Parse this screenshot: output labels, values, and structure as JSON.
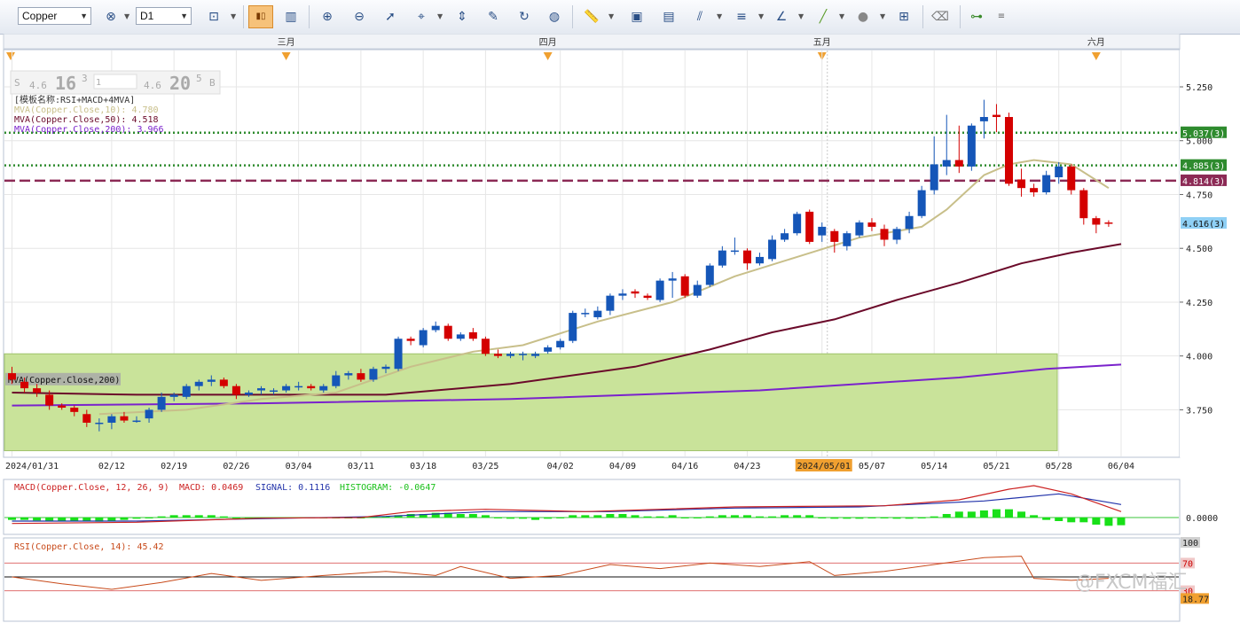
{
  "toolbar": {
    "symbol": "Copper",
    "timeframe": "D1",
    "icons": [
      "indicator-remove-icon",
      "chart-type-icon",
      "candlestick-icon",
      "bar-chart-icon",
      "zoom-in-icon",
      "zoom-out-icon",
      "cursor-icon",
      "crosshair-data-icon",
      "fit-icon",
      "properties-icon",
      "refresh-icon",
      "globe-icon",
      "ruler-icon",
      "image-icon",
      "snapshot-icon",
      "fibonacci-icon",
      "horizontal-lines-icon",
      "trend-tools-icon",
      "pen-icon",
      "ellipse-icon",
      "add-indicator-icon",
      "eraser-icon",
      "tree-icon",
      "more-icon"
    ]
  },
  "chart_data": [
    {
      "type": "candlestick",
      "symbol": "Copper",
      "timeframe": "D1",
      "month_labels": [
        "三月",
        "四月",
        "五月",
        "六月"
      ],
      "x_tick_labels": [
        "2024/01/31",
        "02/12",
        "02/19",
        "02/26",
        "03/04",
        "03/11",
        "03/18",
        "03/25",
        "04/02",
        "04/09",
        "04/16",
        "04/23",
        "2024/05/01",
        "05/07",
        "05/14",
        "05/21",
        "05/28",
        "06/04"
      ],
      "y_ticks": [
        "5.250",
        "5.000",
        "4.750",
        "4.500",
        "4.250",
        "4.000",
        "3.750"
      ],
      "ylim": [
        3.55,
        5.32
      ],
      "grid": true,
      "template_label": "[模板名称:RSI+MACD+4MVA]",
      "price_box": {
        "sell_prefix": "S",
        "sell_small": "4.6",
        "sell_big": "16",
        "sell_sup": "3",
        "lot": "1",
        "buy_small": "4.6",
        "buy_big": "20",
        "buy_sup": "5",
        "buy_suffix": "B"
      },
      "legend": [
        {
          "text": "MVA(Copper.Close,10): 4.780",
          "color": "#c8bf8a"
        },
        {
          "text": "MVA(Copper.Close,50): 4.518",
          "color": "#6b0a2a"
        },
        {
          "text": "MVA(Copper.Close,200): 3.966",
          "color": "#7a22cc"
        }
      ],
      "zone_label": "MVA(Copper.Close,200)",
      "zone": {
        "y_from": 3.56,
        "y_to": 4.01
      },
      "hlines": [
        {
          "value": 5.037,
          "label": "5.037(3)",
          "style": "dotted",
          "color": "#2e8b2e"
        },
        {
          "value": 4.885,
          "label": "4.885(3)",
          "style": "dotted",
          "color": "#2e8b2e"
        },
        {
          "value": 4.814,
          "label": "4.814(3)",
          "style": "dashed",
          "color": "#8c2a55"
        }
      ],
      "last_price_label": "4.616(3)",
      "last_price": 4.616,
      "candles": [
        {
          "o": 3.92,
          "c": 3.89,
          "h": 3.95,
          "l": 3.87
        },
        {
          "o": 3.88,
          "c": 3.85,
          "h": 3.9,
          "l": 3.83
        },
        {
          "o": 3.85,
          "c": 3.83,
          "h": 3.87,
          "l": 3.81
        },
        {
          "o": 3.82,
          "c": 3.77,
          "h": 3.84,
          "l": 3.75
        },
        {
          "o": 3.77,
          "c": 3.76,
          "h": 3.78,
          "l": 3.75
        },
        {
          "o": 3.76,
          "c": 3.74,
          "h": 3.77,
          "l": 3.72
        },
        {
          "o": 3.73,
          "c": 3.69,
          "h": 3.75,
          "l": 3.67
        },
        {
          "o": 3.69,
          "c": 3.69,
          "h": 3.71,
          "l": 3.65
        },
        {
          "o": 3.69,
          "c": 3.72,
          "h": 3.73,
          "l": 3.66
        },
        {
          "o": 3.72,
          "c": 3.7,
          "h": 3.74,
          "l": 3.69
        },
        {
          "o": 3.7,
          "c": 3.7,
          "h": 3.72,
          "l": 3.69
        },
        {
          "o": 3.71,
          "c": 3.75,
          "h": 3.76,
          "l": 3.69
        },
        {
          "o": 3.75,
          "c": 3.81,
          "h": 3.83,
          "l": 3.74
        },
        {
          "o": 3.81,
          "c": 3.82,
          "h": 3.83,
          "l": 3.79
        },
        {
          "o": 3.81,
          "c": 3.86,
          "h": 3.87,
          "l": 3.8
        },
        {
          "o": 3.86,
          "c": 3.88,
          "h": 3.89,
          "l": 3.84
        },
        {
          "o": 3.88,
          "c": 3.89,
          "h": 3.91,
          "l": 3.86
        },
        {
          "o": 3.89,
          "c": 3.86,
          "h": 3.9,
          "l": 3.85
        },
        {
          "o": 3.86,
          "c": 3.82,
          "h": 3.87,
          "l": 3.8
        },
        {
          "o": 3.82,
          "c": 3.83,
          "h": 3.84,
          "l": 3.81
        },
        {
          "o": 3.84,
          "c": 3.85,
          "h": 3.86,
          "l": 3.82
        },
        {
          "o": 3.84,
          "c": 3.84,
          "h": 3.85,
          "l": 3.82
        },
        {
          "o": 3.84,
          "c": 3.86,
          "h": 3.87,
          "l": 3.83
        },
        {
          "o": 3.86,
          "c": 3.86,
          "h": 3.88,
          "l": 3.84
        },
        {
          "o": 3.86,
          "c": 3.85,
          "h": 3.87,
          "l": 3.84
        },
        {
          "o": 3.84,
          "c": 3.86,
          "h": 3.87,
          "l": 3.83
        },
        {
          "o": 3.86,
          "c": 3.91,
          "h": 3.93,
          "l": 3.85
        },
        {
          "o": 3.91,
          "c": 3.92,
          "h": 3.93,
          "l": 3.89
        },
        {
          "o": 3.92,
          "c": 3.89,
          "h": 3.94,
          "l": 3.88
        },
        {
          "o": 3.89,
          "c": 3.94,
          "h": 3.95,
          "l": 3.88
        },
        {
          "o": 3.94,
          "c": 3.95,
          "h": 3.96,
          "l": 3.92
        },
        {
          "o": 3.94,
          "c": 4.08,
          "h": 4.09,
          "l": 3.93
        },
        {
          "o": 4.08,
          "c": 4.07,
          "h": 4.09,
          "l": 4.05
        },
        {
          "o": 4.05,
          "c": 4.12,
          "h": 4.13,
          "l": 4.04
        },
        {
          "o": 4.12,
          "c": 4.14,
          "h": 4.16,
          "l": 4.11
        },
        {
          "o": 4.14,
          "c": 4.08,
          "h": 4.15,
          "l": 4.07
        },
        {
          "o": 4.08,
          "c": 4.1,
          "h": 4.11,
          "l": 4.07
        },
        {
          "o": 4.11,
          "c": 4.08,
          "h": 4.13,
          "l": 4.07
        },
        {
          "o": 4.08,
          "c": 4.01,
          "h": 4.09,
          "l": 4.0
        },
        {
          "o": 4.01,
          "c": 4.0,
          "h": 4.03,
          "l": 3.99
        },
        {
          "o": 4.0,
          "c": 4.01,
          "h": 4.02,
          "l": 3.99
        },
        {
          "o": 4.01,
          "c": 4.01,
          "h": 4.02,
          "l": 3.98
        },
        {
          "o": 4.0,
          "c": 4.01,
          "h": 4.02,
          "l": 3.99
        },
        {
          "o": 4.02,
          "c": 4.04,
          "h": 4.05,
          "l": 4.01
        },
        {
          "o": 4.04,
          "c": 4.07,
          "h": 4.08,
          "l": 4.03
        },
        {
          "o": 4.07,
          "c": 4.2,
          "h": 4.21,
          "l": 4.06
        },
        {
          "o": 4.2,
          "c": 4.2,
          "h": 4.22,
          "l": 4.18
        },
        {
          "o": 4.18,
          "c": 4.21,
          "h": 4.23,
          "l": 4.17
        },
        {
          "o": 4.21,
          "c": 4.28,
          "h": 4.29,
          "l": 4.19
        },
        {
          "o": 4.28,
          "c": 4.29,
          "h": 4.31,
          "l": 4.26
        },
        {
          "o": 4.3,
          "c": 4.29,
          "h": 4.31,
          "l": 4.27
        },
        {
          "o": 4.28,
          "c": 4.27,
          "h": 4.29,
          "l": 4.26
        },
        {
          "o": 4.26,
          "c": 4.35,
          "h": 4.36,
          "l": 4.25
        },
        {
          "o": 4.35,
          "c": 4.36,
          "h": 4.39,
          "l": 4.27
        },
        {
          "o": 4.37,
          "c": 4.28,
          "h": 4.38,
          "l": 4.27
        },
        {
          "o": 4.28,
          "c": 4.33,
          "h": 4.35,
          "l": 4.27
        },
        {
          "o": 4.33,
          "c": 4.42,
          "h": 4.43,
          "l": 4.32
        },
        {
          "o": 4.42,
          "c": 4.49,
          "h": 4.51,
          "l": 4.41
        },
        {
          "o": 4.49,
          "c": 4.49,
          "h": 4.55,
          "l": 4.47
        },
        {
          "o": 4.49,
          "c": 4.43,
          "h": 4.5,
          "l": 4.4
        },
        {
          "o": 4.43,
          "c": 4.46,
          "h": 4.48,
          "l": 4.42
        },
        {
          "o": 4.45,
          "c": 4.54,
          "h": 4.56,
          "l": 4.44
        },
        {
          "o": 4.54,
          "c": 4.57,
          "h": 4.59,
          "l": 4.53
        },
        {
          "o": 4.57,
          "c": 4.66,
          "h": 4.67,
          "l": 4.56
        },
        {
          "o": 4.67,
          "c": 4.53,
          "h": 4.68,
          "l": 4.52
        },
        {
          "o": 4.56,
          "c": 4.6,
          "h": 4.62,
          "l": 4.53
        },
        {
          "o": 4.58,
          "c": 4.53,
          "h": 4.59,
          "l": 4.48
        },
        {
          "o": 4.51,
          "c": 4.57,
          "h": 4.58,
          "l": 4.49
        },
        {
          "o": 4.56,
          "c": 4.62,
          "h": 4.63,
          "l": 4.55
        },
        {
          "o": 4.62,
          "c": 4.6,
          "h": 4.64,
          "l": 4.58
        },
        {
          "o": 4.59,
          "c": 4.54,
          "h": 4.61,
          "l": 4.51
        },
        {
          "o": 4.54,
          "c": 4.59,
          "h": 4.6,
          "l": 4.52
        },
        {
          "o": 4.59,
          "c": 4.65,
          "h": 4.67,
          "l": 4.57
        },
        {
          "o": 4.65,
          "c": 4.77,
          "h": 4.79,
          "l": 4.64
        },
        {
          "o": 4.77,
          "c": 4.89,
          "h": 5.02,
          "l": 4.75
        },
        {
          "o": 4.88,
          "c": 4.91,
          "h": 5.12,
          "l": 4.84
        },
        {
          "o": 4.91,
          "c": 4.88,
          "h": 5.07,
          "l": 4.85
        },
        {
          "o": 4.88,
          "c": 5.07,
          "h": 5.08,
          "l": 4.86
        },
        {
          "o": 5.09,
          "c": 5.11,
          "h": 5.19,
          "l": 5.01
        },
        {
          "o": 5.12,
          "c": 5.11,
          "h": 5.17,
          "l": 5.04
        },
        {
          "o": 5.11,
          "c": 4.8,
          "h": 5.13,
          "l": 4.79
        },
        {
          "o": 4.82,
          "c": 4.78,
          "h": 4.87,
          "l": 4.74
        },
        {
          "o": 4.78,
          "c": 4.76,
          "h": 4.8,
          "l": 4.74
        },
        {
          "o": 4.76,
          "c": 4.84,
          "h": 4.86,
          "l": 4.75
        },
        {
          "o": 4.83,
          "c": 4.88,
          "h": 4.9,
          "l": 4.8
        },
        {
          "o": 4.88,
          "c": 4.77,
          "h": 4.89,
          "l": 4.75
        },
        {
          "o": 4.77,
          "c": 4.64,
          "h": 4.78,
          "l": 4.61
        },
        {
          "o": 4.64,
          "c": 4.61,
          "h": 4.65,
          "l": 4.57
        },
        {
          "o": 4.62,
          "c": 4.616,
          "h": 4.63,
          "l": 4.6
        }
      ],
      "mva10": [
        [
          7,
          3.73
        ],
        [
          14,
          3.75
        ],
        [
          20,
          3.8
        ],
        [
          26,
          3.83
        ],
        [
          32,
          3.95
        ],
        [
          37,
          4.02
        ],
        [
          41,
          4.05
        ],
        [
          47,
          4.16
        ],
        [
          53,
          4.25
        ],
        [
          58,
          4.37
        ],
        [
          63,
          4.46
        ],
        [
          68,
          4.55
        ],
        [
          73,
          4.6
        ],
        [
          75,
          4.68
        ],
        [
          78,
          4.84
        ],
        [
          80,
          4.89
        ],
        [
          82,
          4.91
        ],
        [
          85,
          4.89
        ],
        [
          88,
          4.78
        ]
      ],
      "mva50": [
        [
          0,
          3.83
        ],
        [
          10,
          3.82
        ],
        [
          20,
          3.82
        ],
        [
          30,
          3.82
        ],
        [
          40,
          3.87
        ],
        [
          50,
          3.95
        ],
        [
          56,
          4.03
        ],
        [
          61,
          4.11
        ],
        [
          66,
          4.17
        ],
        [
          71,
          4.26
        ],
        [
          76,
          4.34
        ],
        [
          81,
          4.43
        ],
        [
          85,
          4.48
        ],
        [
          89,
          4.52
        ]
      ],
      "mva200": [
        [
          0,
          3.77
        ],
        [
          20,
          3.78
        ],
        [
          40,
          3.8
        ],
        [
          60,
          3.84
        ],
        [
          76,
          3.9
        ],
        [
          83,
          3.94
        ],
        [
          89,
          3.96
        ]
      ]
    },
    {
      "type": "macd",
      "label": "MACD(Copper.Close, 12, 26, 9)",
      "macd_text": "MACD: 0.0469",
      "signal_text": "SIGNAL: 0.1116",
      "hist_text": "HISTOGRAM: -0.0647",
      "y_tick": "0.0000",
      "ylim": [
        -0.12,
        0.3
      ],
      "macd_line": [
        [
          0,
          -0.05
        ],
        [
          10,
          -0.04
        ],
        [
          20,
          -0.005
        ],
        [
          28,
          0.0
        ],
        [
          32,
          0.05
        ],
        [
          38,
          0.07
        ],
        [
          46,
          0.05
        ],
        [
          58,
          0.09
        ],
        [
          70,
          0.1
        ],
        [
          76,
          0.15
        ],
        [
          80,
          0.24
        ],
        [
          82,
          0.27
        ],
        [
          85,
          0.2
        ],
        [
          89,
          0.05
        ]
      ],
      "signal_line": [
        [
          0,
          -0.03
        ],
        [
          10,
          -0.03
        ],
        [
          20,
          -0.01
        ],
        [
          30,
          0.01
        ],
        [
          38,
          0.05
        ],
        [
          48,
          0.05
        ],
        [
          58,
          0.08
        ],
        [
          68,
          0.09
        ],
        [
          78,
          0.14
        ],
        [
          84,
          0.2
        ],
        [
          89,
          0.11
        ]
      ],
      "histogram": [
        -0.02,
        -0.02,
        -0.025,
        -0.03,
        -0.03,
        -0.03,
        -0.03,
        -0.035,
        -0.03,
        -0.02,
        -0.01,
        0.0,
        0.01,
        0.02,
        0.02,
        0.02,
        0.02,
        0.01,
        0.0,
        0.0,
        0.0,
        0.0,
        0.0,
        0.0,
        0.0,
        0.0,
        0.0,
        0.0,
        0.0,
        0.01,
        0.01,
        0.02,
        0.03,
        0.03,
        0.04,
        0.04,
        0.03,
        0.03,
        0.02,
        0.0,
        -0.01,
        -0.01,
        -0.02,
        -0.01,
        0.0,
        0.02,
        0.02,
        0.02,
        0.03,
        0.03,
        0.02,
        0.01,
        0.01,
        0.02,
        0.0,
        0.0,
        0.01,
        0.02,
        0.02,
        0.02,
        0.01,
        0.01,
        0.02,
        0.02,
        0.02,
        0.0,
        -0.01,
        -0.01,
        -0.01,
        0.0,
        0.0,
        -0.01,
        -0.01,
        0.0,
        0.01,
        0.03,
        0.05,
        0.05,
        0.06,
        0.07,
        0.07,
        0.05,
        0.02,
        -0.02,
        -0.03,
        -0.04,
        -0.04,
        -0.06,
        -0.07,
        -0.065
      ]
    },
    {
      "type": "rsi",
      "label": "RSI(Copper.Close, 14): 45.42",
      "y_ticks": [
        "100",
        "70",
        "30",
        "18.77"
      ],
      "levels": [
        70,
        50,
        30
      ],
      "ylim": [
        0,
        100
      ],
      "rsi_line": [
        [
          0,
          50
        ],
        [
          4,
          40
        ],
        [
          8,
          32
        ],
        [
          12,
          42
        ],
        [
          16,
          55
        ],
        [
          20,
          45
        ],
        [
          25,
          52
        ],
        [
          30,
          58
        ],
        [
          34,
          52
        ],
        [
          36,
          65
        ],
        [
          40,
          48
        ],
        [
          44,
          52
        ],
        [
          48,
          68
        ],
        [
          52,
          62
        ],
        [
          56,
          70
        ],
        [
          60,
          65
        ],
        [
          64,
          72
        ],
        [
          66,
          52
        ],
        [
          70,
          58
        ],
        [
          74,
          68
        ],
        [
          78,
          78
        ],
        [
          81,
          80
        ],
        [
          82,
          48
        ],
        [
          85,
          45
        ],
        [
          88,
          48
        ]
      ]
    }
  ],
  "watermark": "@FXCM福汇"
}
